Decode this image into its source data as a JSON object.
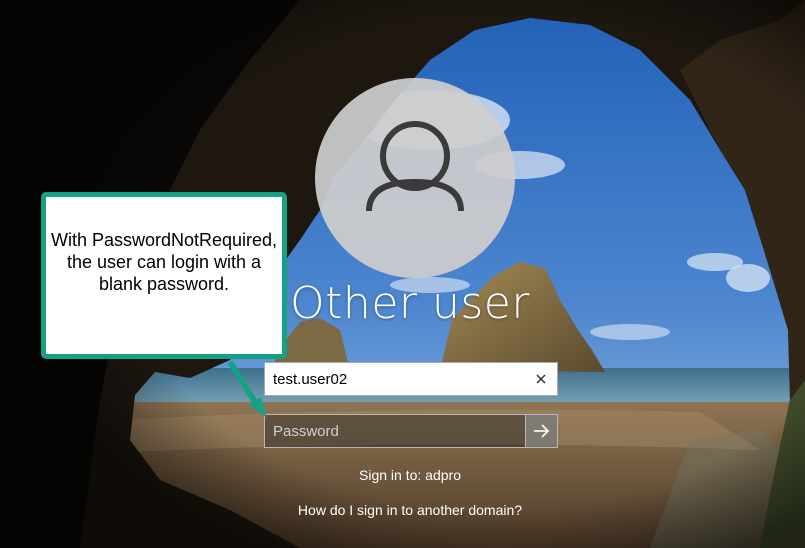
{
  "login": {
    "username_display": "Other user",
    "username_value": "test.user02",
    "password_placeholder": "Password",
    "sign_in_to": "Sign in to: adpro",
    "other_domain_link": "How do I sign in to another domain?"
  },
  "callout": {
    "text": "With PasswordNotRequired, the user can login with a blank password."
  },
  "icons": {
    "avatar": "user-silhouette-icon",
    "clear": "close-icon",
    "submit": "arrow-right-icon"
  },
  "colors": {
    "callout_border": "#16a184",
    "avatar_bg": "#cdcdcd",
    "avatar_icon": "#3a3a3a"
  }
}
